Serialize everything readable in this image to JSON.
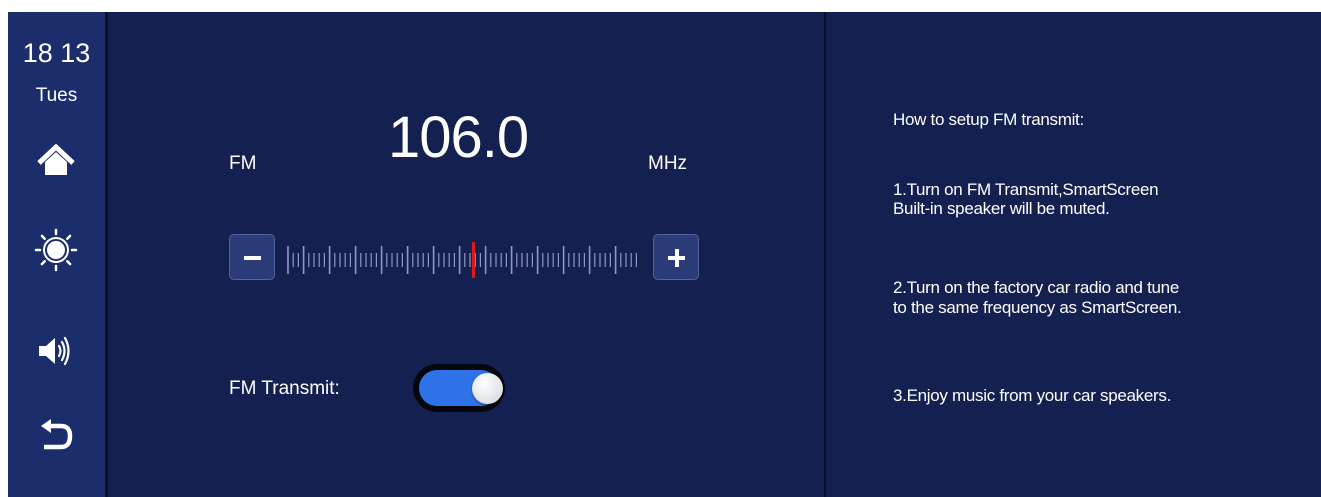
{
  "status": {
    "time": "18 13",
    "day": "Tues"
  },
  "sidebar": {
    "items": [
      {
        "icon": "home-icon"
      },
      {
        "icon": "brightness-icon"
      },
      {
        "icon": "volume-icon"
      },
      {
        "icon": "back-icon"
      }
    ]
  },
  "tuner": {
    "band": "FM",
    "frequency": "106.0",
    "unit": "MHz"
  },
  "transmit": {
    "label": "FM Transmit:",
    "enabled": true
  },
  "help": {
    "title": "How to setup FM transmit:",
    "step1_line1": "1.Turn on FM Transmit,SmartScreen",
    "step1_line2": "Built-in speaker will be muted.",
    "step2_line1": "2.Turn on the factory car radio and tune",
    "step2_line2": "to the same frequency as SmartScreen.",
    "step3": "3.Enjoy music from your car speakers."
  },
  "colors": {
    "background": "#142150",
    "sidebar": "#1c2d6c",
    "toggle_on": "#2f71e6",
    "tuner_marker": "#e01818"
  }
}
